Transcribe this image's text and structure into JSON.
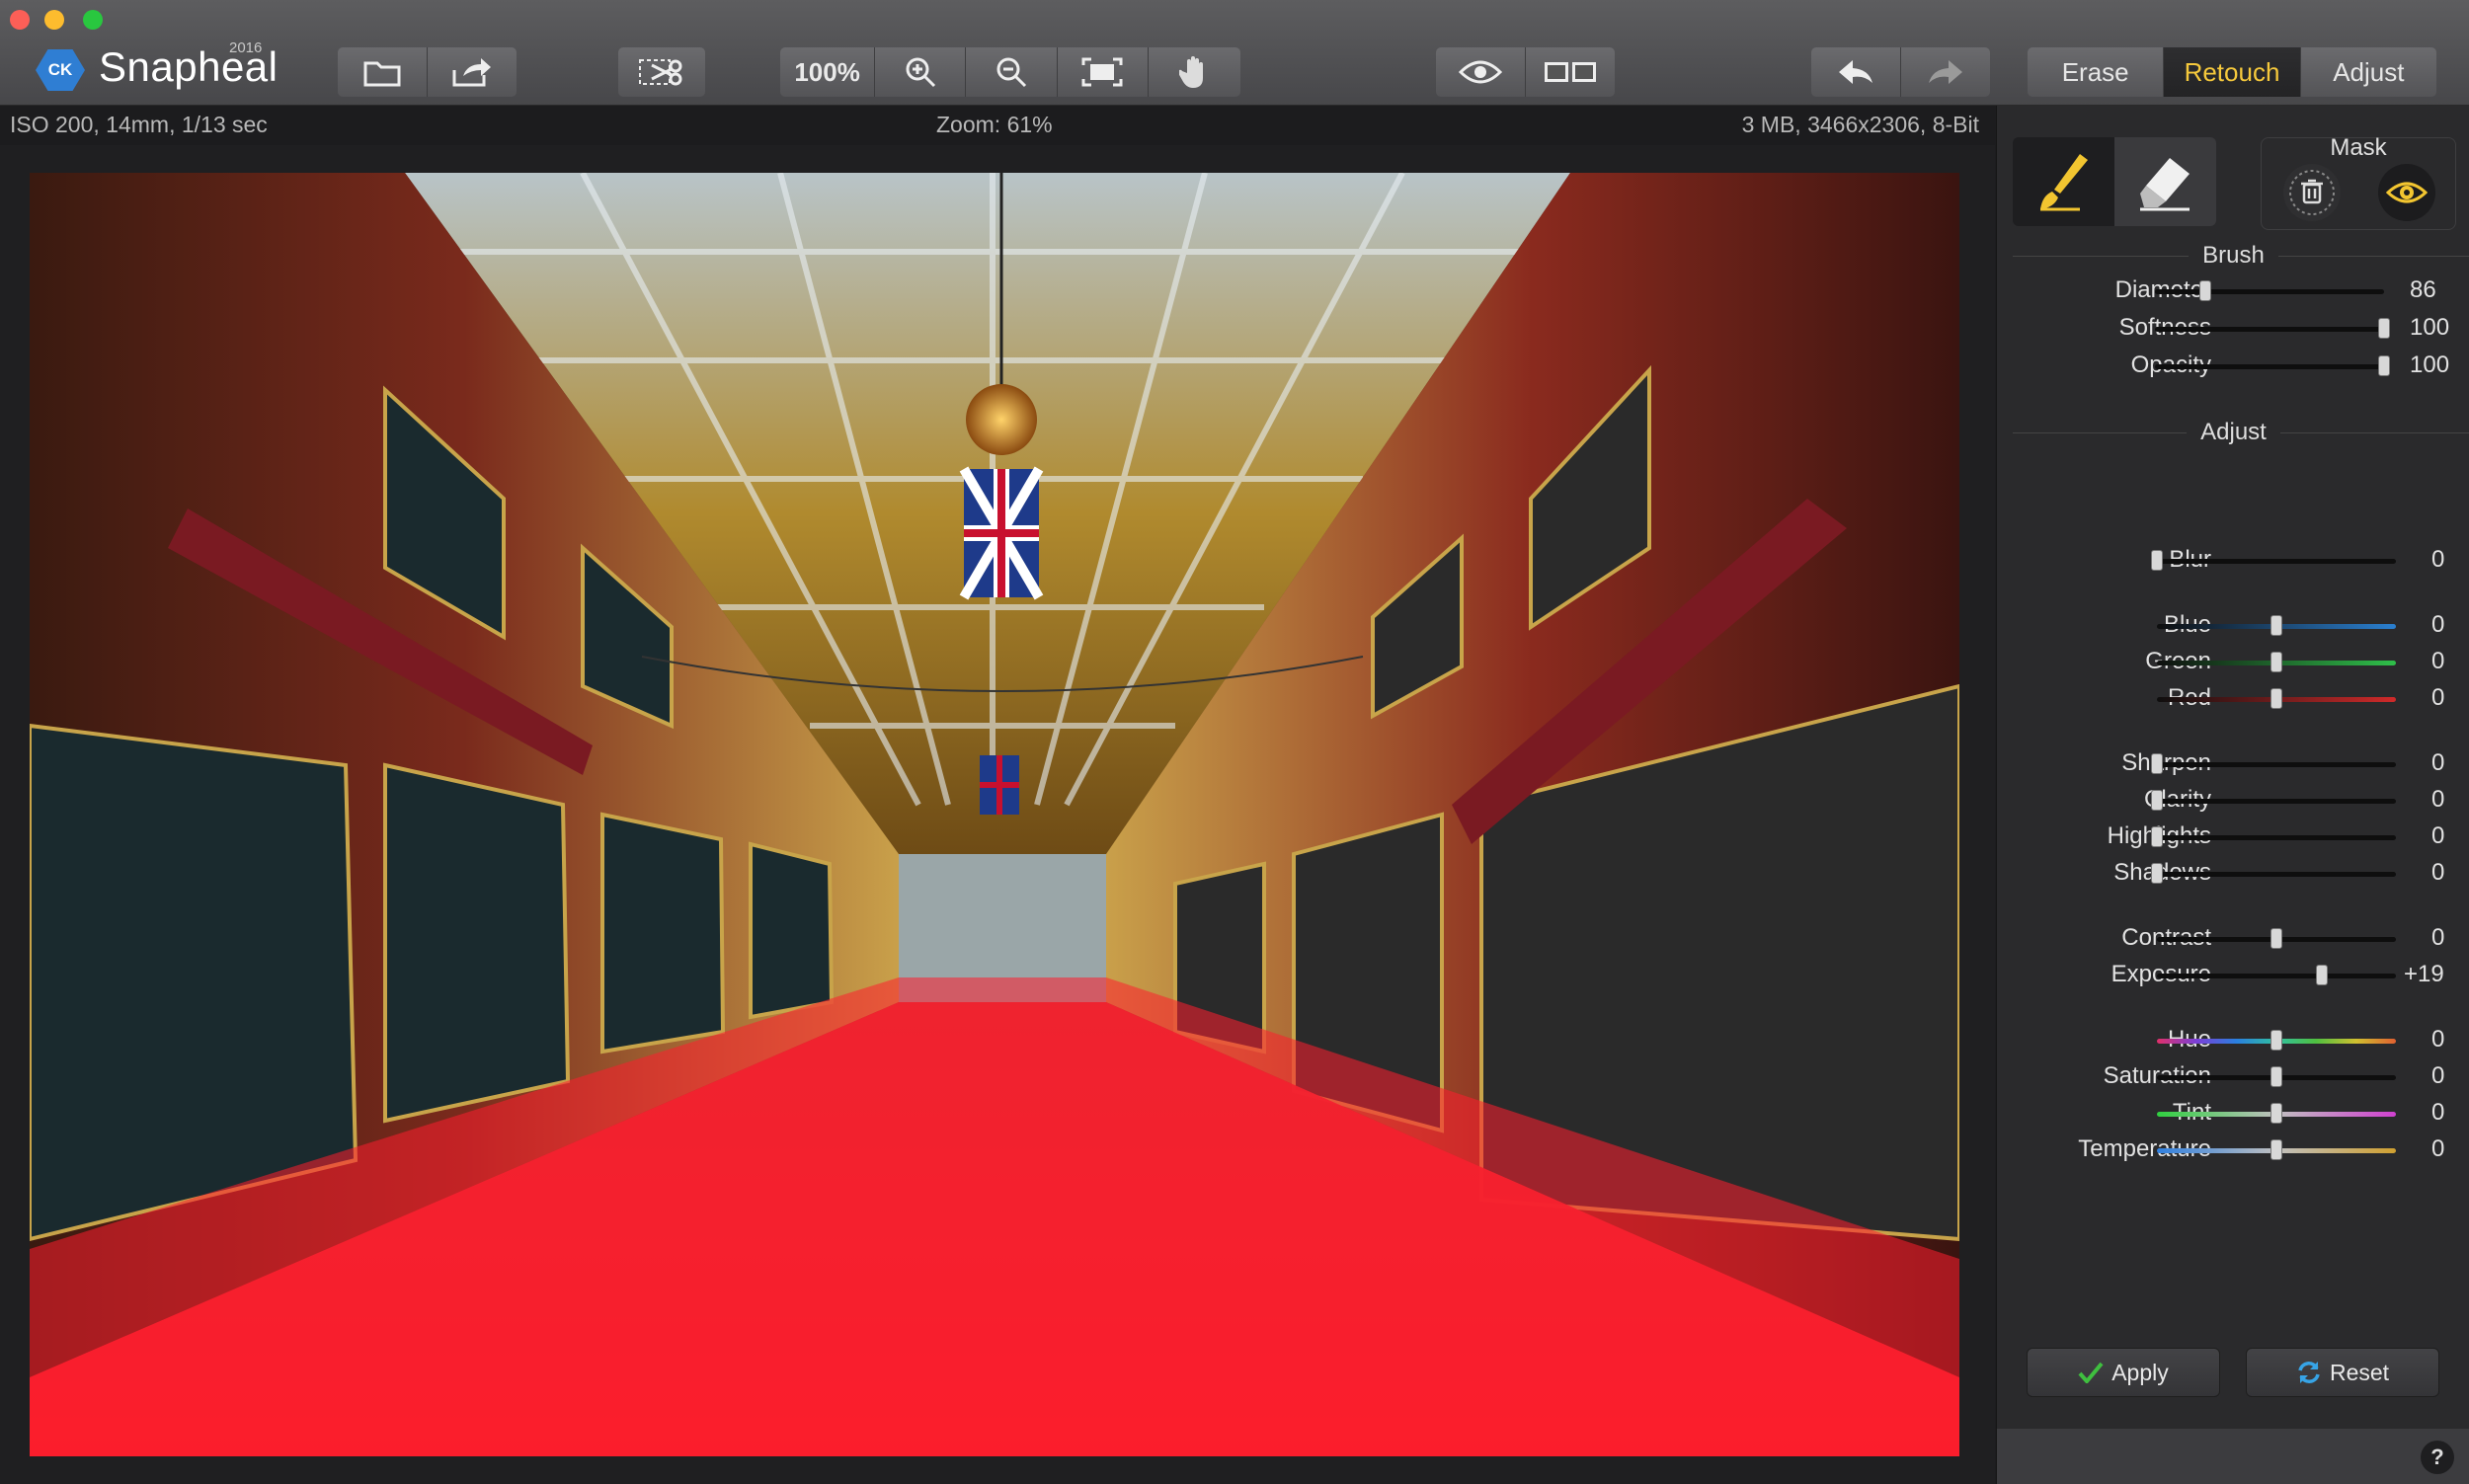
{
  "app": {
    "name": "Snapheal",
    "year": "2016",
    "badge": "CK"
  },
  "toolbar": {
    "zoom_100": "100%",
    "modes": [
      {
        "label": "Erase",
        "active": false
      },
      {
        "label": "Retouch",
        "active": true
      },
      {
        "label": "Adjust",
        "active": false
      }
    ]
  },
  "info": {
    "camera": "ISO 200, 14mm, 1/13 sec",
    "zoom": "Zoom: 61%",
    "file": "3 MB, 3466x2306, 8-Bit"
  },
  "panel": {
    "mask_title": "Mask",
    "brush_title": "Brush",
    "adjust_title": "Adjust",
    "brush": [
      {
        "label": "Diameter",
        "value": "86",
        "level": 0.22
      },
      {
        "label": "Softness",
        "value": "100",
        "level": 1.0
      },
      {
        "label": "Opacity",
        "value": "100",
        "level": 1.0
      }
    ],
    "adjust": [
      {
        "label": "Blur",
        "value": "0",
        "level": 0.0,
        "track": "dark"
      },
      {
        "label": "Blue",
        "value": "0",
        "level": 0.5,
        "track": "blue"
      },
      {
        "label": "Green",
        "value": "0",
        "level": 0.5,
        "track": "green"
      },
      {
        "label": "Red",
        "value": "0",
        "level": 0.5,
        "track": "red"
      },
      {
        "label": "Sharpen",
        "value": "0",
        "level": 0.0,
        "track": "dark"
      },
      {
        "label": "Clarity",
        "value": "0",
        "level": 0.0,
        "track": "dark"
      },
      {
        "label": "Highlights",
        "value": "0",
        "level": 0.0,
        "track": "dark"
      },
      {
        "label": "Shadows",
        "value": "0",
        "level": 0.0,
        "track": "dark"
      },
      {
        "label": "Contrast",
        "value": "0",
        "level": 0.5,
        "track": "dark"
      },
      {
        "label": "Exposure",
        "value": "+19",
        "level": 0.69,
        "track": "dark"
      },
      {
        "label": "Hue",
        "value": "0",
        "level": 0.5,
        "track": "hue"
      },
      {
        "label": "Saturation",
        "value": "0",
        "level": 0.5,
        "track": "dark"
      },
      {
        "label": "Tint",
        "value": "0",
        "level": 0.5,
        "track": "tint"
      },
      {
        "label": "Temperature",
        "value": "0",
        "level": 0.5,
        "track": "temp"
      }
    ],
    "apply_label": "Apply",
    "reset_label": "Reset",
    "help_label": "?"
  },
  "colors": {
    "accent": "#f6c93c",
    "mask": "#ff1e2d"
  }
}
